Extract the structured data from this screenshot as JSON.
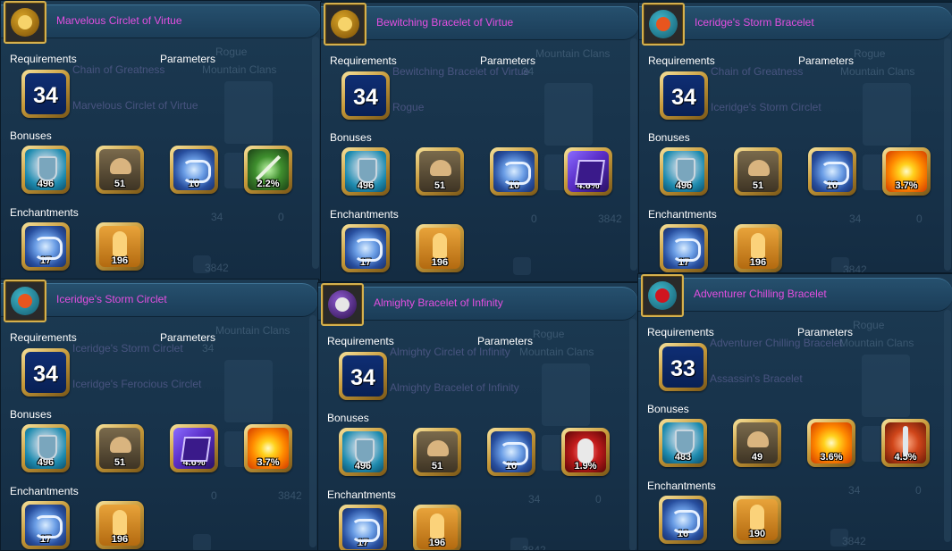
{
  "headers": {
    "requirements": "Requirements",
    "parameters": "Parameters",
    "bonuses": "Bonuses",
    "enchantments": "Enchantments"
  },
  "panels": [
    {
      "title": "Marvelous Circlet of Virtue",
      "icon": "gold-circlet-icon",
      "level": "34",
      "bonuses": [
        {
          "icon": "armor-icon",
          "value": "496"
        },
        {
          "icon": "strength-icon",
          "value": "51"
        },
        {
          "icon": "scroll-icon",
          "value": "10"
        },
        {
          "icon": "sword-icon",
          "value": "2.2%"
        }
      ],
      "enchantments": [
        {
          "icon": "scroll-icon",
          "value": "17"
        },
        {
          "icon": "body-icon",
          "value": "196"
        }
      ]
    },
    {
      "title": "Bewitching Bracelet of Virtue",
      "icon": "gold-bracelet-icon",
      "level": "34",
      "bonuses": [
        {
          "icon": "armor-icon",
          "value": "496"
        },
        {
          "icon": "strength-icon",
          "value": "51"
        },
        {
          "icon": "scroll-icon",
          "value": "10"
        },
        {
          "icon": "book-icon",
          "value": "4.6%"
        }
      ],
      "enchantments": [
        {
          "icon": "scroll-icon",
          "value": "17"
        },
        {
          "icon": "body-icon",
          "value": "196"
        }
      ]
    },
    {
      "title": "Iceridge's Storm Bracelet",
      "icon": "ice-bracelet-icon",
      "level": "34",
      "bonuses": [
        {
          "icon": "armor-icon",
          "value": "496"
        },
        {
          "icon": "strength-icon",
          "value": "51"
        },
        {
          "icon": "scroll-icon",
          "value": "10"
        },
        {
          "icon": "spiral-icon",
          "value": "3.7%"
        }
      ],
      "enchantments": [
        {
          "icon": "scroll-icon",
          "value": "17"
        },
        {
          "icon": "body-icon",
          "value": "196"
        }
      ]
    },
    {
      "title": "Iceridge's Storm Circlet",
      "icon": "ice-circlet-icon",
      "level": "34",
      "bonuses": [
        {
          "icon": "armor-icon",
          "value": "496"
        },
        {
          "icon": "strength-icon",
          "value": "51"
        },
        {
          "icon": "book-icon",
          "value": "4.6%"
        },
        {
          "icon": "spiral-icon",
          "value": "3.7%"
        }
      ],
      "enchantments": [
        {
          "icon": "scroll-icon",
          "value": "17"
        },
        {
          "icon": "body-icon",
          "value": "196"
        }
      ]
    },
    {
      "title": "Almighty Bracelet of Infinity",
      "icon": "skull-bracelet-icon",
      "level": "34",
      "bonuses": [
        {
          "icon": "armor-icon",
          "value": "496"
        },
        {
          "icon": "strength-icon",
          "value": "51"
        },
        {
          "icon": "scroll-icon",
          "value": "10"
        },
        {
          "icon": "glove-icon",
          "value": "1.9%"
        }
      ],
      "enchantments": [
        {
          "icon": "scroll-icon",
          "value": "17"
        },
        {
          "icon": "body-icon",
          "value": "196"
        }
      ]
    },
    {
      "title": "Adventurer Chilling Bracelet",
      "icon": "ruby-bracelet-icon",
      "level": "33",
      "bonuses": [
        {
          "icon": "armor-icon",
          "value": "483"
        },
        {
          "icon": "strength-icon",
          "value": "49"
        },
        {
          "icon": "spiral-icon",
          "value": "3.6%"
        },
        {
          "icon": "sword2-icon",
          "value": "4.5%"
        }
      ],
      "enchantments": [
        {
          "icon": "scroll-icon",
          "value": "16"
        },
        {
          "icon": "body-icon",
          "value": "190"
        }
      ]
    }
  ],
  "background_texts": [
    [
      "Chain of Greatness",
      "Marvelous Circlet of Virtue",
      "Rogue",
      "Mountain Clans",
      "34",
      "0",
      "3842"
    ],
    [
      "Bewitching Bracelet of Virtue",
      "Rogue",
      "Mountain Clans",
      "34",
      "0",
      "3842"
    ],
    [
      "Chain of Greatness",
      "Iceridge's Storm Circlet",
      "Rogue",
      "Mountain Clans",
      "34",
      "0",
      "3842"
    ],
    [
      "Iceridge's Storm Circlet",
      "Iceridge's Ferocious Circlet",
      "Mountain Clans",
      "34",
      "0",
      "3842"
    ],
    [
      "Almighty Circlet of Infinity",
      "Almighty Bracelet of Infinity",
      "Rogue",
      "Mountain Clans",
      "34",
      "0",
      "3842"
    ],
    [
      "Adventurer Chilling Bracelet",
      "Assassin's Bracelet",
      "Rogue",
      "Mountain Clans",
      "34",
      "0",
      "3842"
    ]
  ],
  "colors": {
    "title": "#e34fe0",
    "header": "#ffffff",
    "tile_gold": "#d5b04e",
    "panel_bg": "#1a3650"
  }
}
